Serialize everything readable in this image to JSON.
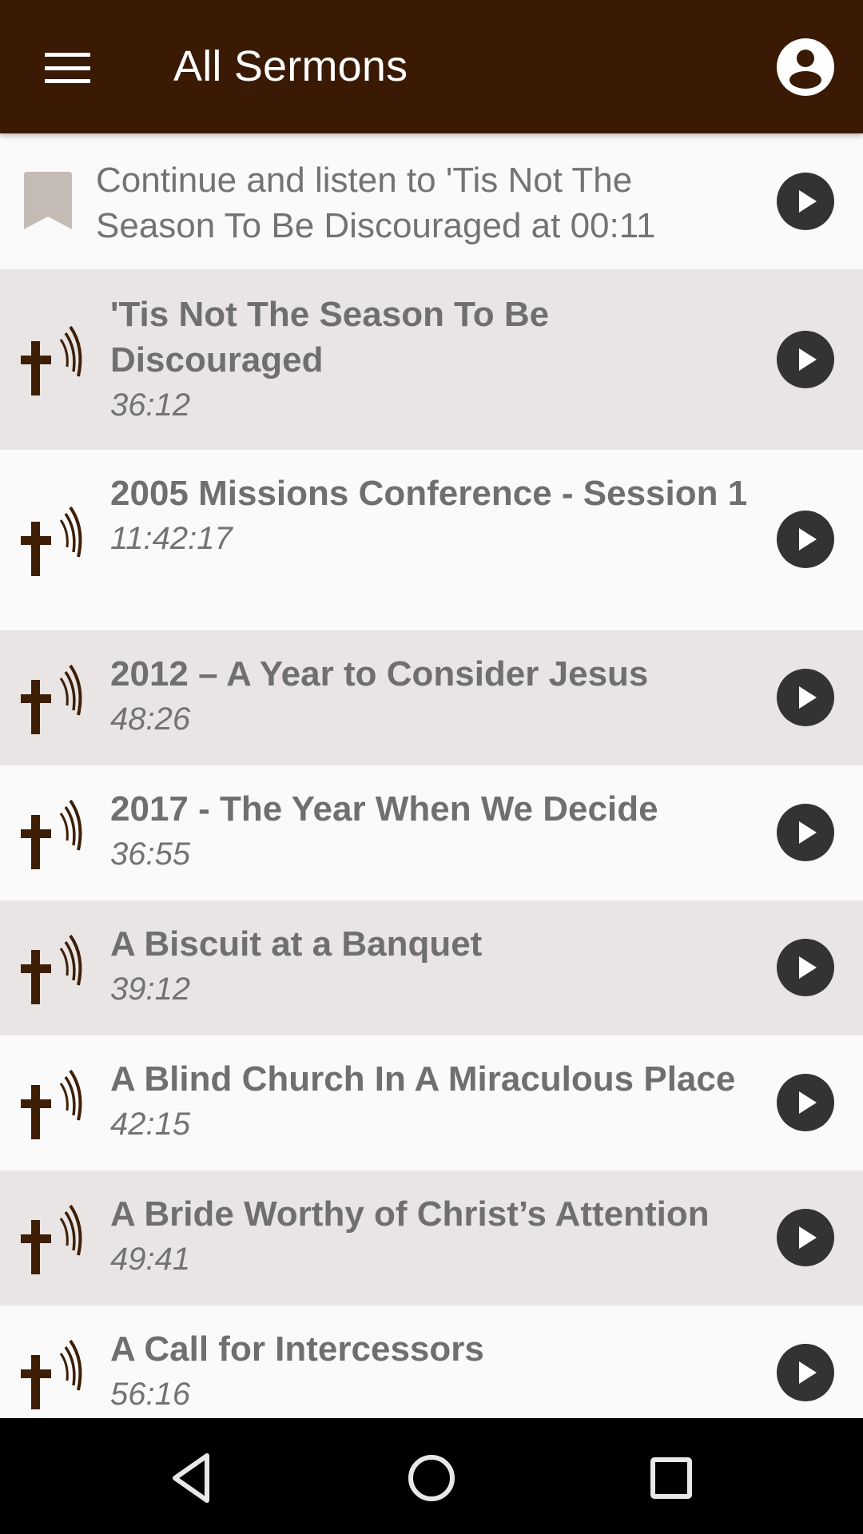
{
  "appbar": {
    "title": "All Sermons",
    "menu_icon": "hamburger-menu-icon",
    "account_icon": "account-circle-icon",
    "background_color": "#3a1a04"
  },
  "continue": {
    "icon": "bookmark-icon",
    "text": "Continue and listen to 'Tis Not The Season To Be Discouraged at 00:11",
    "play_icon": "play-circle-icon"
  },
  "sermons": [
    {
      "title": "'Tis Not The Season To Be Discouraged",
      "duration": "36:12"
    },
    {
      "title": "2005 Missions Conference - Session 1",
      "duration": "11:42:17"
    },
    {
      "title": "2012 – A Year to Consider Jesus",
      "duration": "48:26"
    },
    {
      "title": "2017 - The Year When We Decide",
      "duration": "36:55"
    },
    {
      "title": "A Biscuit at a Banquet",
      "duration": "39:12"
    },
    {
      "title": "A Blind Church In A Miraculous Place",
      "duration": "42:15"
    },
    {
      "title": "A Bride Worthy of Christ’s Attention",
      "duration": "49:41"
    },
    {
      "title": "A Call for Intercessors",
      "duration": "56:16"
    }
  ],
  "navbar": {
    "back_icon": "back-triangle-icon",
    "home_icon": "home-circle-icon",
    "recents_icon": "recents-square-icon"
  },
  "colors": {
    "accent_brown": "#3a1a04",
    "row_gray": "#e8e5e4",
    "row_white": "#fafafa",
    "text_gray": "#6f6f6f",
    "play_dark": "#333333",
    "bookmark_beige": "#c4bbb4"
  }
}
